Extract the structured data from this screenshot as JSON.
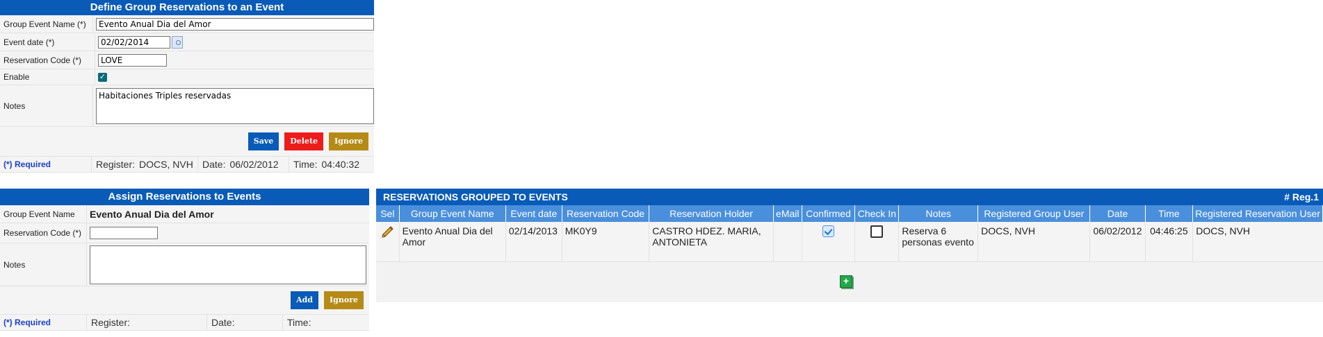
{
  "define_panel": {
    "title": "Define Group Reservations to an Event",
    "labels": {
      "group_event_name": "Group Event Name (*)",
      "event_date": "Event date (*)",
      "reservation_code": "Reservation Code (*)",
      "enable": "Enable",
      "notes": "Notes"
    },
    "values": {
      "group_event_name": "Evento Anual Dia del Amor",
      "event_date": "02/02/2014",
      "reservation_code": "LOVE",
      "notes": "Habitaciones Triples reservadas"
    },
    "buttons": {
      "save": "Save",
      "delete": "Delete",
      "ignore": "Ignore"
    },
    "footer": {
      "required": "(*) Required",
      "register_label": "Register:",
      "register_value": "DOCS, NVH",
      "date_label": "Date:",
      "date_value": "06/02/2012",
      "time_label": "Time:",
      "time_value": "04:40:32"
    }
  },
  "assign_panel": {
    "title": "Assign Reservations to Events",
    "labels": {
      "group_event_name": "Group Event Name",
      "reservation_code": "Reservation Code (*)",
      "notes": "Notes"
    },
    "values": {
      "group_event_name": "Evento Anual Dia del Amor",
      "reservation_code": "",
      "notes": ""
    },
    "buttons": {
      "add": "Add",
      "ignore": "Ignore"
    },
    "footer": {
      "required": "(*) Required",
      "register_label": "Register:",
      "date_label": "Date:",
      "time_label": "Time:"
    }
  },
  "grid": {
    "title": "RESERVATIONS GROUPED TO EVENTS",
    "reg": "# Reg.1",
    "columns": [
      "Sel",
      "Group Event Name",
      "Event date",
      "Reservation Code",
      "Reservation Holder",
      "eMail",
      "Confirmed",
      "Check In",
      "Notes",
      "Registered Group User",
      "Date",
      "Time",
      "Registered Reservation User"
    ],
    "row": {
      "group_event_name": "Evento Anual Dia del Amor",
      "event_date": "02/14/2013",
      "reservation_code": "MK0Y9",
      "reservation_holder": "CASTRO HDEZ. MARIA, ANTONIETA",
      "email": "",
      "confirmed": true,
      "check_in": false,
      "notes": "Reserva 6 personas evento",
      "registered_group_user": "DOCS, NVH",
      "date": "06/02/2012",
      "time": "04:46:25",
      "registered_reservation_user": "DOCS, NVH"
    }
  },
  "icons": {
    "edit": "pencil-icon",
    "add": "add-row-icon",
    "calendar": "calendar-icon"
  },
  "colors": {
    "header_blue": "#0a5bb8",
    "column_blue": "#4a8fdc",
    "delete_red": "#ee1b1b",
    "ignore_gold": "#b58a16"
  }
}
